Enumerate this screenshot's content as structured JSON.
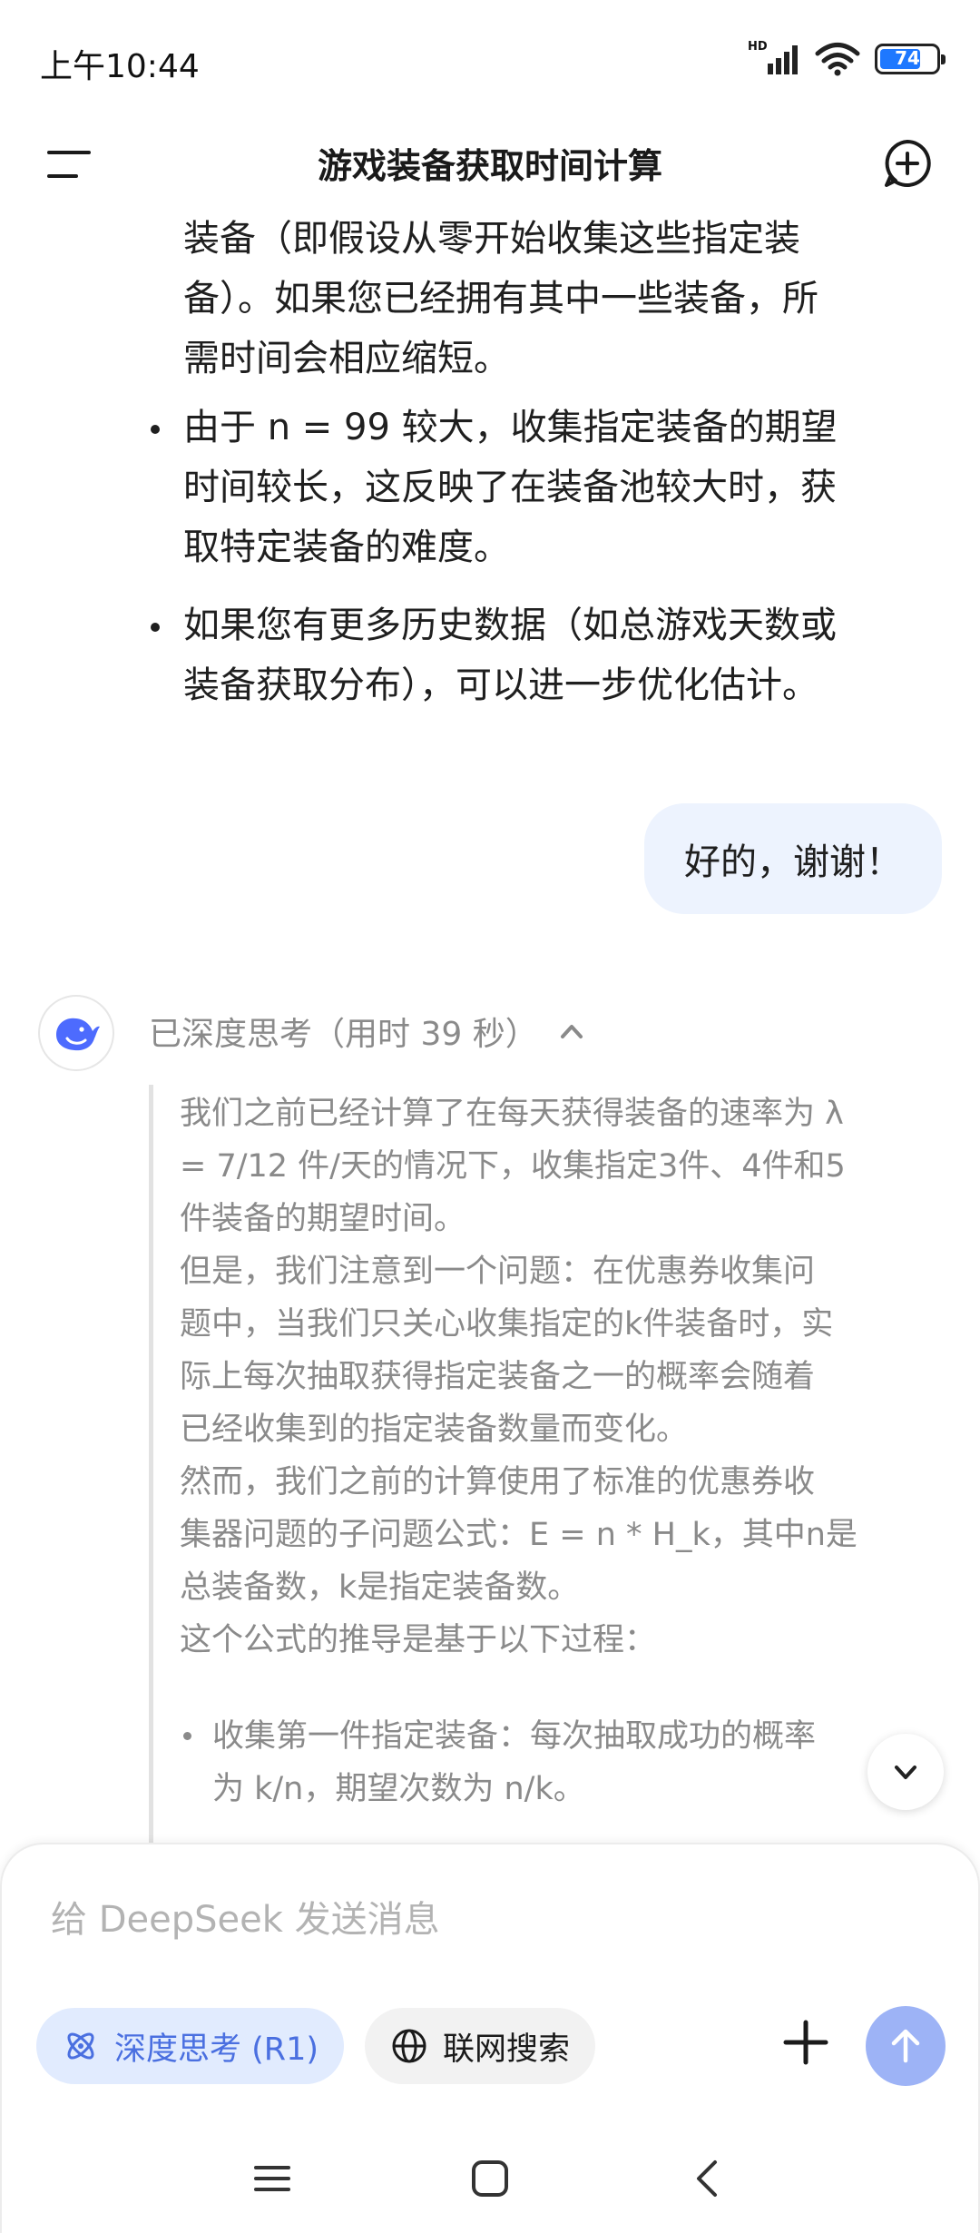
{
  "status_bar": {
    "time": "上午10:44",
    "network_label": "HD",
    "battery": "74",
    "battery_level": 0.74
  },
  "header": {
    "title": "游戏装备获取时间计算",
    "menu_icon": "menu-icon",
    "new_chat_icon": "new-chat-icon"
  },
  "answer": {
    "para_tail": [
      "装备（即假设从零开始收集这些指定装",
      "备）。如果您已经拥有其中一些装备，所",
      "需时间会相应缩短。"
    ],
    "bullets": [
      [
        "由于 n = 99 较大，收集指定装备的期望",
        "时间较长，这反映了在装备池较大时，获",
        "取特定装备的难度。"
      ],
      [
        "如果您有更多历史数据（如总游戏天数或",
        "装备获取分布），可以进一步优化估计。"
      ]
    ]
  },
  "user_message": "好的，谢谢！",
  "thinking": {
    "header": "已深度思考（用时 39 秒）",
    "lines": [
      "我们之前已经计算了在每天获得装备的速率为 λ",
      "= 7/12 件/天的情况下，收集指定3件、4件和5",
      "件装备的期望时间。",
      "但是，我们注意到一个问题：在优惠券收集问",
      "题中，当我们只关心收集指定的k件装备时，实",
      "际上每次抽取获得指定装备之一的概率会随着",
      "已经收集到的指定装备数量而变化。",
      "然而，我们之前的计算使用了标准的优惠券收",
      "集器问题的子问题公式：E = n * H_k，其中n是",
      "总装备数，k是指定装备数。",
      "这个公式的推导是基于以下过程："
    ],
    "bullet_lines": [
      "收集第一件指定装备：每次抽取成功的概率",
      "为 k/n，期望次数为 n/k。"
    ]
  },
  "input": {
    "placeholder": "给 DeepSeek 发送消息",
    "deep_think_label": "深度思考 (R1)",
    "web_search_label": "联网搜索"
  },
  "colors": {
    "accent": "#4a6fe0",
    "user_bubble": "#edf3fe",
    "send_button": "#9db3f6",
    "thinking_text": "#8a8a8a"
  }
}
